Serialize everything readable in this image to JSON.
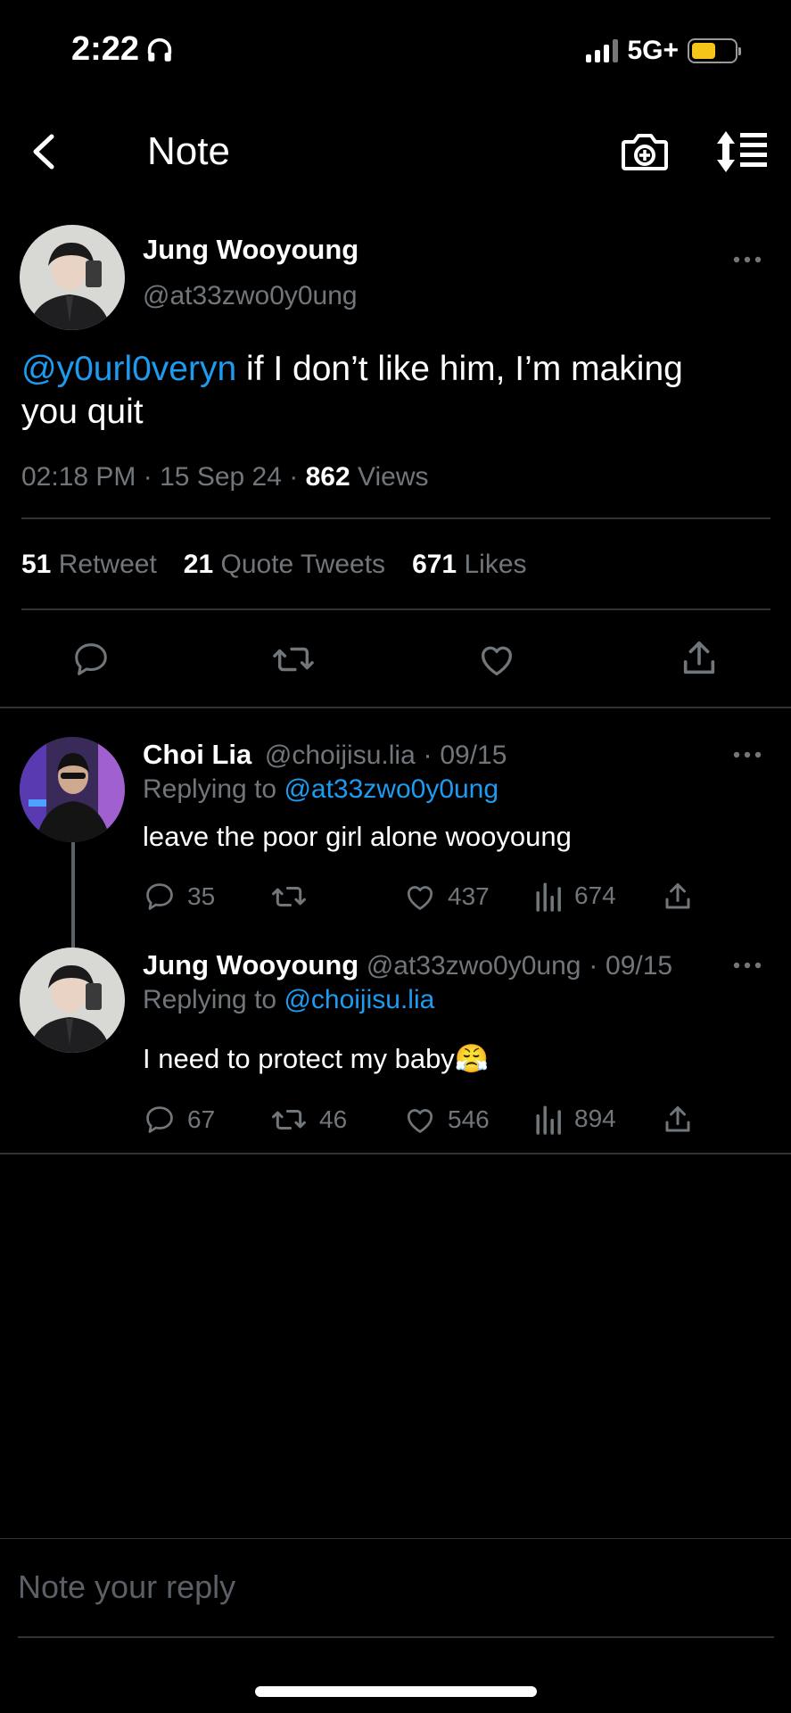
{
  "status_bar": {
    "time": "2:22",
    "network": "5G+"
  },
  "header": {
    "title": "Note"
  },
  "tweet": {
    "author_name": "Jung Wooyoung",
    "author_handle": "@at33zwo0y0ung",
    "mention": "@y0url0veryn",
    "text_line1": " if I don’t like him, I’m making",
    "text_line2": "you quit",
    "time": "02:18 PM",
    "date": "15 Sep 24",
    "views_count": "862",
    "views_label": "Views",
    "retweet_count": "51",
    "retweet_label": "Retweet",
    "quote_count": "21",
    "quote_label": "Quote Tweets",
    "likes_count": "671",
    "likes_label": "Likes"
  },
  "replies": [
    {
      "name": "Choi Lia",
      "handle": "@choijisu.lia",
      "date": "09/15",
      "replying_label": "Replying to",
      "replying_to": "@at33zwo0y0ung",
      "text": "leave the poor girl alone wooyoung",
      "reply_count": "35",
      "retweet_count": "",
      "like_count": "437",
      "view_count": "674"
    },
    {
      "name": "Jung Wooyoung",
      "handle": "@at33zwo0y0ung",
      "date": "09/15",
      "replying_label": "Replying to",
      "replying_to": "@choijisu.lia",
      "text": "I need to protect my baby😤",
      "reply_count": "67",
      "retweet_count": "46",
      "like_count": "546",
      "view_count": "894"
    }
  ],
  "composer": {
    "placeholder": "Note your reply"
  },
  "separator": "·",
  "icons": [
    "back-icon",
    "camera-plus-icon",
    "sort-list-icon",
    "more-icon",
    "reply-icon",
    "retweet-icon",
    "like-icon",
    "share-icon",
    "views-icon",
    "headphones-icon"
  ],
  "colors": {
    "background": "#000000",
    "link": "#1d9bf0",
    "muted": "#71767b",
    "battery": "#f5c518"
  }
}
